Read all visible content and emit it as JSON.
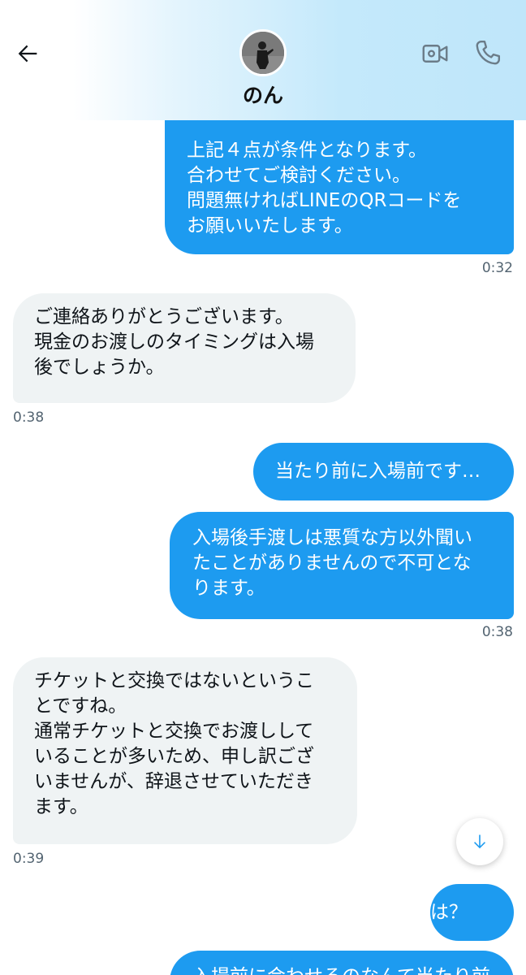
{
  "header": {
    "contact_name": "のん"
  },
  "messages": [
    {
      "direction": "out",
      "text": "上記４点が条件となります。\n合わせてご検討ください。\n問題無ければLINEのQRコードを\nお願いいたします。",
      "time": "0:32"
    },
    {
      "direction": "in",
      "text": "ご連絡ありがとうございます。\n現金のお渡しのタイミングは入場\n後でしょうか。",
      "time": "0:38"
    },
    {
      "direction": "out",
      "text": "当たり前に入場前です…"
    },
    {
      "direction": "out",
      "text": "入場後手渡しは悪質な方以外聞い\nたことがありませんので不可とな\nります。",
      "time": "0:38"
    },
    {
      "direction": "in",
      "text": "チケットと交換ではないというこ\nとですね。\n通常チケットと交換でお渡しして\nいることが多いため、申し訳ござ\nいませんが、辞退させていただき\nます。",
      "time": "0:39"
    },
    {
      "direction": "out",
      "text": "は？"
    },
    {
      "direction": "out",
      "text": "入場前に会わせるのなんて当たり前"
    }
  ],
  "icons": {
    "back": "arrow-left-icon",
    "video": "video-camera-icon",
    "call": "phone-icon",
    "scroll": "arrow-down-icon"
  },
  "colors": {
    "outgoing_bubble": "#1d9bf0",
    "incoming_bubble": "#eff3f4",
    "accent": "#1d9bf0"
  }
}
